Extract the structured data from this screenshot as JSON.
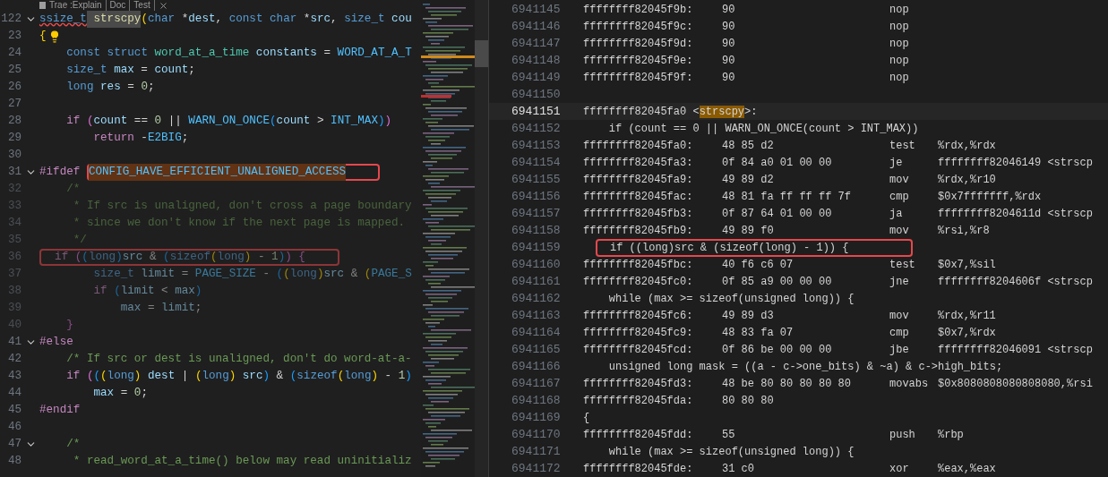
{
  "editor": {
    "codelens": [
      "Trae :Explain",
      "Doc",
      "Test"
    ],
    "lines": [
      {
        "num": "122",
        "fold": true,
        "hint": false,
        "inactive": false,
        "tokens": [
          {
            "kind": "flagged",
            "t": "ssize_t"
          },
          {
            "kind": "match",
            "t": " strscpy"
          },
          {
            "kind": "b1",
            "t": "("
          },
          {
            "kind": "kw",
            "t": "char"
          },
          {
            "kind": "p",
            "t": " *"
          },
          {
            "kind": "var",
            "t": "dest"
          },
          {
            "kind": "p",
            "t": ","
          },
          {
            "kind": "kw",
            "t": " const"
          },
          {
            "kind": "kw",
            "t": " char"
          },
          {
            "kind": "p",
            "t": " *"
          },
          {
            "kind": "var",
            "t": "src"
          },
          {
            "kind": "p",
            "t": ","
          },
          {
            "kind": "kw",
            "t": " size_t"
          },
          {
            "kind": "var",
            "t": " cou"
          }
        ]
      },
      {
        "num": "23",
        "fold": false,
        "hint": true,
        "inactive": false,
        "tokens": [
          {
            "kind": "b1",
            "t": "{"
          }
        ]
      },
      {
        "num": "24",
        "fold": false,
        "hint": false,
        "inactive": false,
        "tokens": [
          {
            "kind": "kw",
            "t": "    const"
          },
          {
            "kind": "kw",
            "t": " struct"
          },
          {
            "kind": "type",
            "t": " word_at_a_time"
          },
          {
            "kind": "var",
            "t": " constants"
          },
          {
            "kind": "p",
            "t": " ="
          },
          {
            "kind": "mac",
            "t": " WORD_AT_A_T"
          }
        ]
      },
      {
        "num": "25",
        "fold": false,
        "hint": false,
        "inactive": false,
        "tokens": [
          {
            "kind": "kw",
            "t": "    size_t"
          },
          {
            "kind": "var",
            "t": " max"
          },
          {
            "kind": "p",
            "t": " ="
          },
          {
            "kind": "var",
            "t": " count"
          },
          {
            "kind": "p",
            "t": ";"
          }
        ]
      },
      {
        "num": "26",
        "fold": false,
        "hint": false,
        "inactive": false,
        "tokens": [
          {
            "kind": "kw",
            "t": "    long"
          },
          {
            "kind": "var",
            "t": " res"
          },
          {
            "kind": "p",
            "t": " ="
          },
          {
            "kind": "num",
            "t": " 0"
          },
          {
            "kind": "p",
            "t": ";"
          }
        ]
      },
      {
        "num": "27",
        "fold": false,
        "hint": false,
        "inactive": false
      },
      {
        "num": "28",
        "fold": false,
        "hint": false,
        "inactive": false,
        "tokens": [
          {
            "kind": "ctl",
            "t": "    if"
          },
          {
            "kind": "b2",
            "t": " ("
          },
          {
            "kind": "var",
            "t": "count"
          },
          {
            "kind": "p",
            "t": " =="
          },
          {
            "kind": "num",
            "t": " 0"
          },
          {
            "kind": "p",
            "t": " ||"
          },
          {
            "kind": "mac",
            "t": " WARN_ON_ONCE"
          },
          {
            "kind": "b3",
            "t": "("
          },
          {
            "kind": "var",
            "t": "count"
          },
          {
            "kind": "p",
            "t": " >"
          },
          {
            "kind": "mac",
            "t": " INT_MAX"
          },
          {
            "kind": "b3",
            "t": ")"
          },
          {
            "kind": "b2",
            "t": ")"
          }
        ]
      },
      {
        "num": "29",
        "fold": false,
        "hint": false,
        "inactive": false,
        "tokens": [
          {
            "kind": "ctl",
            "t": "        return"
          },
          {
            "kind": "p",
            "t": " -"
          },
          {
            "kind": "mac",
            "t": "E2BIG"
          },
          {
            "kind": "p",
            "t": ";"
          }
        ]
      },
      {
        "num": "30",
        "fold": false,
        "hint": false,
        "inactive": false
      },
      {
        "num": "31",
        "fold": true,
        "hint": false,
        "inactive": false,
        "tokens": [
          {
            "kind": "ctl",
            "t": "#ifdef "
          }
        ],
        "boxed_tokens": [
          {
            "kind": "found",
            "t": "CONFIG_HAVE_EFFICIENT_UNALIGNED_ACCESS"
          }
        ]
      },
      {
        "num": "32",
        "fold": false,
        "hint": false,
        "inactive": true,
        "tokens": [
          {
            "kind": "com",
            "t": "    /*"
          }
        ]
      },
      {
        "num": "33",
        "fold": false,
        "hint": false,
        "inactive": true,
        "tokens": [
          {
            "kind": "com",
            "t": "     * If src is unaligned, don't cross a page boundary"
          }
        ]
      },
      {
        "num": "34",
        "fold": false,
        "hint": false,
        "inactive": true,
        "tokens": [
          {
            "kind": "com",
            "t": "     * since we don't know if the next page is mapped."
          }
        ]
      },
      {
        "num": "35",
        "fold": false,
        "hint": false,
        "inactive": true,
        "tokens": [
          {
            "kind": "com",
            "t": "     */"
          }
        ]
      },
      {
        "num": "36",
        "fold": false,
        "hint": false,
        "inactive": true,
        "boxed_tokens": [
          {
            "kind": "ctl",
            "t": "  if"
          },
          {
            "kind": "b2",
            "t": " ("
          },
          {
            "kind": "b3",
            "t": "("
          },
          {
            "kind": "kw",
            "t": "long"
          },
          {
            "kind": "b3",
            "t": ")"
          },
          {
            "kind": "var",
            "t": "src"
          },
          {
            "kind": "p",
            "t": " &"
          },
          {
            "kind": "b3",
            "t": " ("
          },
          {
            "kind": "kw",
            "t": "sizeof"
          },
          {
            "kind": "b1",
            "t": "("
          },
          {
            "kind": "kw",
            "t": "long"
          },
          {
            "kind": "b1",
            "t": ")"
          },
          {
            "kind": "p",
            "t": " -"
          },
          {
            "kind": "num",
            "t": " 1"
          },
          {
            "kind": "b3",
            "t": ")"
          },
          {
            "kind": "b2",
            "t": ")"
          },
          {
            "kind": "b2",
            "t": " {"
          }
        ]
      },
      {
        "num": "37",
        "fold": false,
        "hint": false,
        "inactive": true,
        "tokens": [
          {
            "kind": "kw",
            "t": "        size_t"
          },
          {
            "kind": "var",
            "t": " limit"
          },
          {
            "kind": "p",
            "t": " ="
          },
          {
            "kind": "mac",
            "t": " PAGE_SIZE"
          },
          {
            "kind": "p",
            "t": " -"
          },
          {
            "kind": "b3",
            "t": " ("
          },
          {
            "kind": "b1",
            "t": "("
          },
          {
            "kind": "kw",
            "t": "long"
          },
          {
            "kind": "b1",
            "t": ")"
          },
          {
            "kind": "var",
            "t": "src"
          },
          {
            "kind": "p",
            "t": " &"
          },
          {
            "kind": "b1",
            "t": " ("
          },
          {
            "kind": "mac",
            "t": "PAGE_S"
          }
        ]
      },
      {
        "num": "38",
        "fold": false,
        "hint": false,
        "inactive": true,
        "tokens": [
          {
            "kind": "ctl",
            "t": "        if"
          },
          {
            "kind": "b3",
            "t": " ("
          },
          {
            "kind": "var",
            "t": "limit"
          },
          {
            "kind": "p",
            "t": " <"
          },
          {
            "kind": "var",
            "t": " max"
          },
          {
            "kind": "b3",
            "t": ")"
          }
        ]
      },
      {
        "num": "39",
        "fold": false,
        "hint": false,
        "inactive": true,
        "tokens": [
          {
            "kind": "var",
            "t": "            max"
          },
          {
            "kind": "p",
            "t": " ="
          },
          {
            "kind": "var",
            "t": " limit"
          },
          {
            "kind": "p",
            "t": ";"
          }
        ]
      },
      {
        "num": "40",
        "fold": false,
        "hint": false,
        "inactive": true,
        "tokens": [
          {
            "kind": "b2",
            "t": "    }"
          }
        ]
      },
      {
        "num": "41",
        "fold": true,
        "hint": false,
        "inactive": false,
        "tokens": [
          {
            "kind": "ctl",
            "t": "#else"
          }
        ]
      },
      {
        "num": "42",
        "fold": false,
        "hint": false,
        "inactive": false,
        "tokens": [
          {
            "kind": "com",
            "t": "    /* If src or dest is unaligned, don't do word-at-a-"
          }
        ]
      },
      {
        "num": "43",
        "fold": false,
        "hint": false,
        "inactive": false,
        "tokens": [
          {
            "kind": "ctl",
            "t": "    if"
          },
          {
            "kind": "b2",
            "t": " ("
          },
          {
            "kind": "b3",
            "t": "("
          },
          {
            "kind": "b1",
            "t": "("
          },
          {
            "kind": "kw",
            "t": "long"
          },
          {
            "kind": "b1",
            "t": ")"
          },
          {
            "kind": "var",
            "t": " dest"
          },
          {
            "kind": "p",
            "t": " |"
          },
          {
            "kind": "b1",
            "t": " ("
          },
          {
            "kind": "kw",
            "t": "long"
          },
          {
            "kind": "b1",
            "t": ")"
          },
          {
            "kind": "var",
            "t": " src"
          },
          {
            "kind": "b3",
            "t": ")"
          },
          {
            "kind": "p",
            "t": " &"
          },
          {
            "kind": "b3",
            "t": " ("
          },
          {
            "kind": "kw",
            "t": "sizeof"
          },
          {
            "kind": "b1",
            "t": "("
          },
          {
            "kind": "kw",
            "t": "long"
          },
          {
            "kind": "b1",
            "t": ")"
          },
          {
            "kind": "p",
            "t": " -"
          },
          {
            "kind": "num",
            "t": " 1"
          },
          {
            "kind": "b3",
            "t": ")"
          }
        ]
      },
      {
        "num": "44",
        "fold": false,
        "hint": false,
        "inactive": false,
        "tokens": [
          {
            "kind": "var",
            "t": "        max"
          },
          {
            "kind": "p",
            "t": " ="
          },
          {
            "kind": "num",
            "t": " 0"
          },
          {
            "kind": "p",
            "t": ";"
          }
        ]
      },
      {
        "num": "45",
        "fold": false,
        "hint": false,
        "inactive": false,
        "tokens": [
          {
            "kind": "ctl",
            "t": "#endif"
          }
        ]
      },
      {
        "num": "46",
        "fold": false,
        "hint": false,
        "inactive": false
      },
      {
        "num": "47",
        "fold": true,
        "hint": false,
        "inactive": false,
        "tokens": [
          {
            "kind": "com",
            "t": "    /*"
          }
        ]
      },
      {
        "num": "48",
        "fold": false,
        "hint": false,
        "inactive": false,
        "tokens": [
          {
            "kind": "com",
            "t": "     * read_word_at_a_time() below may read uninitializ"
          }
        ]
      }
    ]
  },
  "disassembly": {
    "rows": [
      {
        "num": "6941145",
        "kind": "asm",
        "current": false,
        "addr": "ffffffff82045f9b:",
        "bytes": "90",
        "mnem": "nop"
      },
      {
        "num": "6941146",
        "kind": "asm",
        "current": false,
        "addr": "ffffffff82045f9c:",
        "bytes": "90",
        "mnem": "nop"
      },
      {
        "num": "6941147",
        "kind": "asm",
        "current": false,
        "addr": "ffffffff82045f9d:",
        "bytes": "90",
        "mnem": "nop"
      },
      {
        "num": "6941148",
        "kind": "asm",
        "current": false,
        "addr": "ffffffff82045f9e:",
        "bytes": "90",
        "mnem": "nop"
      },
      {
        "num": "6941149",
        "kind": "asm",
        "current": false,
        "addr": "ffffffff82045f9f:",
        "bytes": "90",
        "mnem": "nop"
      },
      {
        "num": "6941150",
        "kind": "blank",
        "current": false
      },
      {
        "num": "6941151",
        "kind": "label",
        "current": true,
        "addr": "ffffffff82045fa0 <",
        "symbol": "strscpy",
        "suffix": ">:"
      },
      {
        "num": "6941152",
        "kind": "source",
        "current": false,
        "boxed": false,
        "text": "    if (count == 0 || WARN_ON_ONCE(count > INT_MAX))"
      },
      {
        "num": "6941153",
        "kind": "asm",
        "current": false,
        "addr": "ffffffff82045fa0:",
        "bytes": "48 85 d2",
        "mnem": "test",
        "ops": "%rdx,%rdx"
      },
      {
        "num": "6941154",
        "kind": "asm",
        "current": false,
        "addr": "ffffffff82045fa3:",
        "bytes": "0f 84 a0 01 00 00",
        "mnem": "je",
        "ops": "ffffffff82046149 <strscp"
      },
      {
        "num": "6941155",
        "kind": "asm",
        "current": false,
        "addr": "ffffffff82045fa9:",
        "bytes": "49 89 d2",
        "mnem": "mov",
        "ops": "%rdx,%r10"
      },
      {
        "num": "6941156",
        "kind": "asm",
        "current": false,
        "addr": "ffffffff82045fac:",
        "bytes": "48 81 fa ff ff ff 7f",
        "mnem": "cmp",
        "ops": "$0x7fffffff,%rdx"
      },
      {
        "num": "6941157",
        "kind": "asm",
        "current": false,
        "addr": "ffffffff82045fb3:",
        "bytes": "0f 87 64 01 00 00",
        "mnem": "ja",
        "ops": "ffffffff8204611d <strscp"
      },
      {
        "num": "6941158",
        "kind": "asm",
        "current": false,
        "addr": "ffffffff82045fb9:",
        "bytes": "49 89 f0",
        "mnem": "mov",
        "ops": "%rsi,%r8"
      },
      {
        "num": "6941159",
        "kind": "source",
        "current": false,
        "boxed": true,
        "text": "if ((long)src & (sizeof(long) - 1)) {"
      },
      {
        "num": "6941160",
        "kind": "asm",
        "current": false,
        "addr": "ffffffff82045fbc:",
        "bytes": "40 f6 c6 07",
        "mnem": "test",
        "ops": "$0x7,%sil"
      },
      {
        "num": "6941161",
        "kind": "asm",
        "current": false,
        "addr": "ffffffff82045fc0:",
        "bytes": "0f 85 a9 00 00 00",
        "mnem": "jne",
        "ops": "ffffffff8204606f <strscp"
      },
      {
        "num": "6941162",
        "kind": "source",
        "current": false,
        "boxed": false,
        "text": "    while (max >= sizeof(unsigned long)) {"
      },
      {
        "num": "6941163",
        "kind": "asm",
        "current": false,
        "addr": "ffffffff82045fc6:",
        "bytes": "49 89 d3",
        "mnem": "mov",
        "ops": "%rdx,%r11"
      },
      {
        "num": "6941164",
        "kind": "asm",
        "current": false,
        "addr": "ffffffff82045fc9:",
        "bytes": "48 83 fa 07",
        "mnem": "cmp",
        "ops": "$0x7,%rdx"
      },
      {
        "num": "6941165",
        "kind": "asm",
        "current": false,
        "addr": "ffffffff82045fcd:",
        "bytes": "0f 86 be 00 00 00",
        "mnem": "jbe",
        "ops": "ffffffff82046091 <strscp"
      },
      {
        "num": "6941166",
        "kind": "source",
        "current": false,
        "boxed": false,
        "text": "    unsigned long mask = ((a - c->one_bits) & ~a) & c->high_bits;"
      },
      {
        "num": "6941167",
        "kind": "asm",
        "current": false,
        "addr": "ffffffff82045fd3:",
        "bytes": "48 be 80 80 80 80 80",
        "mnem": "movabs",
        "ops": "$0x8080808080808080,%rsi"
      },
      {
        "num": "6941168",
        "kind": "asm",
        "current": false,
        "addr": "ffffffff82045fda:",
        "bytes": "80 80 80"
      },
      {
        "num": "6941169",
        "kind": "source",
        "current": false,
        "boxed": false,
        "text": "{"
      },
      {
        "num": "6941170",
        "kind": "asm",
        "current": false,
        "addr": "ffffffff82045fdd:",
        "bytes": "55",
        "mnem": "push",
        "ops": "%rbp"
      },
      {
        "num": "6941171",
        "kind": "source",
        "current": false,
        "boxed": false,
        "text": "    while (max >= sizeof(unsigned long)) {"
      },
      {
        "num": "6941172",
        "kind": "asm",
        "current": false,
        "addr": "ffffffff82045fde:",
        "bytes": "31 c0",
        "mnem": "xor",
        "ops": "%eax,%eax"
      }
    ]
  }
}
